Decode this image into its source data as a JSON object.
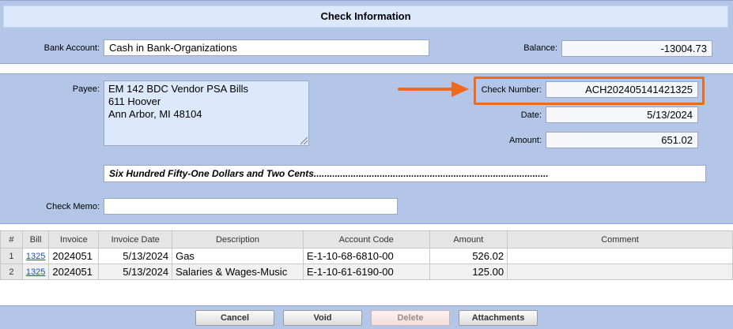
{
  "title": "Check Information",
  "bank_account": {
    "label": "Bank Account:",
    "value": "Cash in Bank-Organizations"
  },
  "balance": {
    "label": "Balance:",
    "value": "-13004.73"
  },
  "payee": {
    "label": "Payee:",
    "lines": [
      "EM 142 BDC Vendor PSA Bills",
      "611 Hoover",
      "Ann Arbor, MI 48104"
    ]
  },
  "check_number": {
    "label": "Check Number:",
    "value": "ACH202405141421325"
  },
  "date": {
    "label": "Date:",
    "value": "5/13/2024"
  },
  "amount": {
    "label": "Amount:",
    "value": "651.02"
  },
  "amount_words": "Six Hundred Fifty-One Dollars and Two Cents.........................................................................................",
  "memo": {
    "label": "Check Memo:",
    "value": ""
  },
  "highlight_color": "#f06a1d",
  "table": {
    "headers": [
      "#",
      "Bill",
      "Invoice",
      "Invoice Date",
      "Description",
      "Account Code",
      "Amount",
      "Comment"
    ],
    "rows": [
      {
        "num": "1",
        "bill": "1325",
        "invoice": "2024051",
        "date": "5/13/2024",
        "description": "Gas",
        "account": "E-1-10-68-6810-00",
        "amount": "526.02",
        "comment": ""
      },
      {
        "num": "2",
        "bill": "1325",
        "invoice": "2024051",
        "date": "5/13/2024",
        "description": "Salaries & Wages-Music",
        "account": "E-1-10-61-6190-00",
        "amount": "125.00",
        "comment": ""
      }
    ]
  },
  "buttons": {
    "cancel": "Cancel",
    "void": "Void",
    "delete": "Delete",
    "attachments": "Attachments"
  }
}
